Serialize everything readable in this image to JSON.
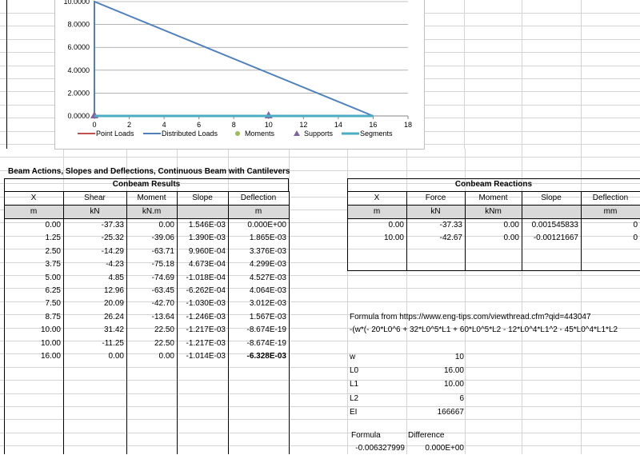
{
  "chart_data": {
    "type": "line",
    "y_ticks": [
      "10.0000",
      "8.0000",
      "6.0000",
      "4.0000",
      "2.0000",
      "0.0000"
    ],
    "x_ticks": [
      "0",
      "2",
      "4",
      "6",
      "8",
      "10",
      "12",
      "14",
      "16",
      "18"
    ],
    "xlim": [
      0,
      18
    ],
    "ylim": [
      0,
      10
    ],
    "series": [
      {
        "name": "Point Loads",
        "color": "#c0504d",
        "x": [],
        "y": []
      },
      {
        "name": "Distributed Loads",
        "color": "#4f81bd",
        "x": [
          0,
          0,
          16
        ],
        "y": [
          0,
          10,
          0
        ]
      },
      {
        "name": "Moments",
        "color": "#9bbb59",
        "x": [],
        "y": []
      },
      {
        "name": "Supports",
        "color": "#8064a2",
        "x": [
          0,
          10
        ],
        "y": [
          0,
          0
        ]
      },
      {
        "name": "Segments",
        "color": "#4bacc6",
        "x": [
          0,
          16
        ],
        "y": [
          0,
          0
        ]
      }
    ],
    "grid": true,
    "legend": "bottom"
  },
  "title": "Beam Actions, Slopes and Deflections, Continuous Beam with Cantilevers",
  "results": {
    "title": "Conbeam Results",
    "headers": [
      "X",
      "Shear",
      "Moment",
      "Slope",
      "Deflection"
    ],
    "units": [
      "m",
      "kN",
      "kN.m",
      "",
      "m"
    ],
    "rows": [
      [
        "0.00",
        "-37.33",
        "0.00",
        "1.546E-03",
        "0.000E+00"
      ],
      [
        "1.25",
        "-25.32",
        "-39.06",
        "1.390E-03",
        "1.865E-03"
      ],
      [
        "2.50",
        "-14.29",
        "-63.71",
        "9.960E-04",
        "3.376E-03"
      ],
      [
        "3.75",
        "-4.23",
        "-75.18",
        "4.673E-04",
        "4.299E-03"
      ],
      [
        "5.00",
        "4.85",
        "-74.69",
        "-1.018E-04",
        "4.527E-03"
      ],
      [
        "6.25",
        "12.96",
        "-63.45",
        "-6.262E-04",
        "4.064E-03"
      ],
      [
        "7.50",
        "20.09",
        "-42.70",
        "-1.030E-03",
        "3.012E-03"
      ],
      [
        "8.75",
        "26.24",
        "-13.64",
        "-1.246E-03",
        "1.567E-03"
      ],
      [
        "10.00",
        "31.42",
        "22.50",
        "-1.217E-03",
        "-8.674E-19"
      ],
      [
        "10.00",
        "-11.25",
        "22.50",
        "-1.217E-03",
        "-8.674E-19"
      ],
      [
        "16.00",
        "0.00",
        "0.00",
        "-1.014E-03",
        "-6.328E-03"
      ]
    ]
  },
  "reactions": {
    "title": "Conbeam Reactions",
    "headers": [
      "X",
      "Force",
      "Moment",
      "Slope",
      "Deflection"
    ],
    "units": [
      "m",
      "kN",
      "kNm",
      "",
      "mm"
    ],
    "rows": [
      [
        "0.00",
        "-37.33",
        "0.00",
        "0.001545833",
        "0"
      ],
      [
        "10.00",
        "-42.67",
        "0.00",
        "-0.00121667",
        "0"
      ]
    ]
  },
  "formula_note": "Formula from https://www.eng-tips.com/viewthread.cfm?qid=443047",
  "formula_text": "-(w*(- 20*L0^6 + 32*L0^5*L1 + 60*L0^5*L2 - 12*L0^4*L1^2 - 45*L0^4*L1*L2",
  "params": [
    {
      "name": "w",
      "value": "10"
    },
    {
      "name": "L0",
      "value": "16.00"
    },
    {
      "name": "L1",
      "value": "10.00"
    },
    {
      "name": "L2",
      "value": "6"
    },
    {
      "name": "EI",
      "value": "166667"
    }
  ],
  "compare": {
    "h1": "Formula",
    "h2": "Difference",
    "v1": "-0.006327999",
    "v2": "0.000E+00"
  }
}
